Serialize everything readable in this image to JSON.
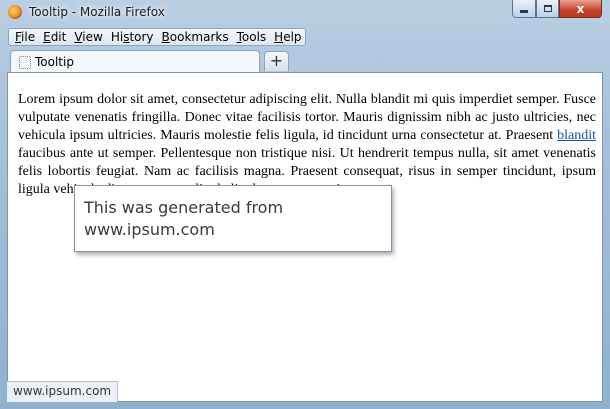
{
  "window": {
    "title": "Tooltip - Mozilla Firefox",
    "close_glyph": "x"
  },
  "menubar": {
    "items": [
      {
        "label_u": "F",
        "label_rest": "ile"
      },
      {
        "label_u": "E",
        "label_rest": "dit"
      },
      {
        "label_u": "V",
        "label_rest": "iew"
      },
      {
        "label_pre": "Hi",
        "label_u": "s",
        "label_rest": "tory"
      },
      {
        "label_u": "B",
        "label_rest": "ookmarks"
      },
      {
        "label_u": "T",
        "label_rest": "ools"
      },
      {
        "label_u": "H",
        "label_rest": "elp"
      }
    ]
  },
  "tabs": {
    "active_label": "Tooltip",
    "new_tab_glyph": "+"
  },
  "page": {
    "paragraph_before_link": "Lorem ipsum dolor sit amet, consectetur adipiscing elit. Nulla blandit mi quis imperdiet semper. Fusce vulputate venenatis fringilla. Donec vitae facilisis tortor. Mauris dignissim nibh ac justo ultricies, nec vehicula ipsum ultricies. Mauris molestie felis ligula, id tincidunt urna consectetur at. Praesent ",
    "link_text": "blandit",
    "paragraph_after_link": " faucibus ante ut semper. Pellentesque non tristique nisi. Ut hendrerit tempus nulla, sit amet venenatis felis lobortis feugiat. Nam ac facilisis magna. Praesent consequat, risus in semper tincidunt, ipsum ligula vehicula diam, eu ornare ligula ligula rutrum mauris."
  },
  "tooltip": {
    "text": "This was generated from www.ipsum.com"
  },
  "statusbar": {
    "url": "www.ipsum.com"
  },
  "colors": {
    "link": "#1f4fb3",
    "close_button": "#c7442a"
  }
}
